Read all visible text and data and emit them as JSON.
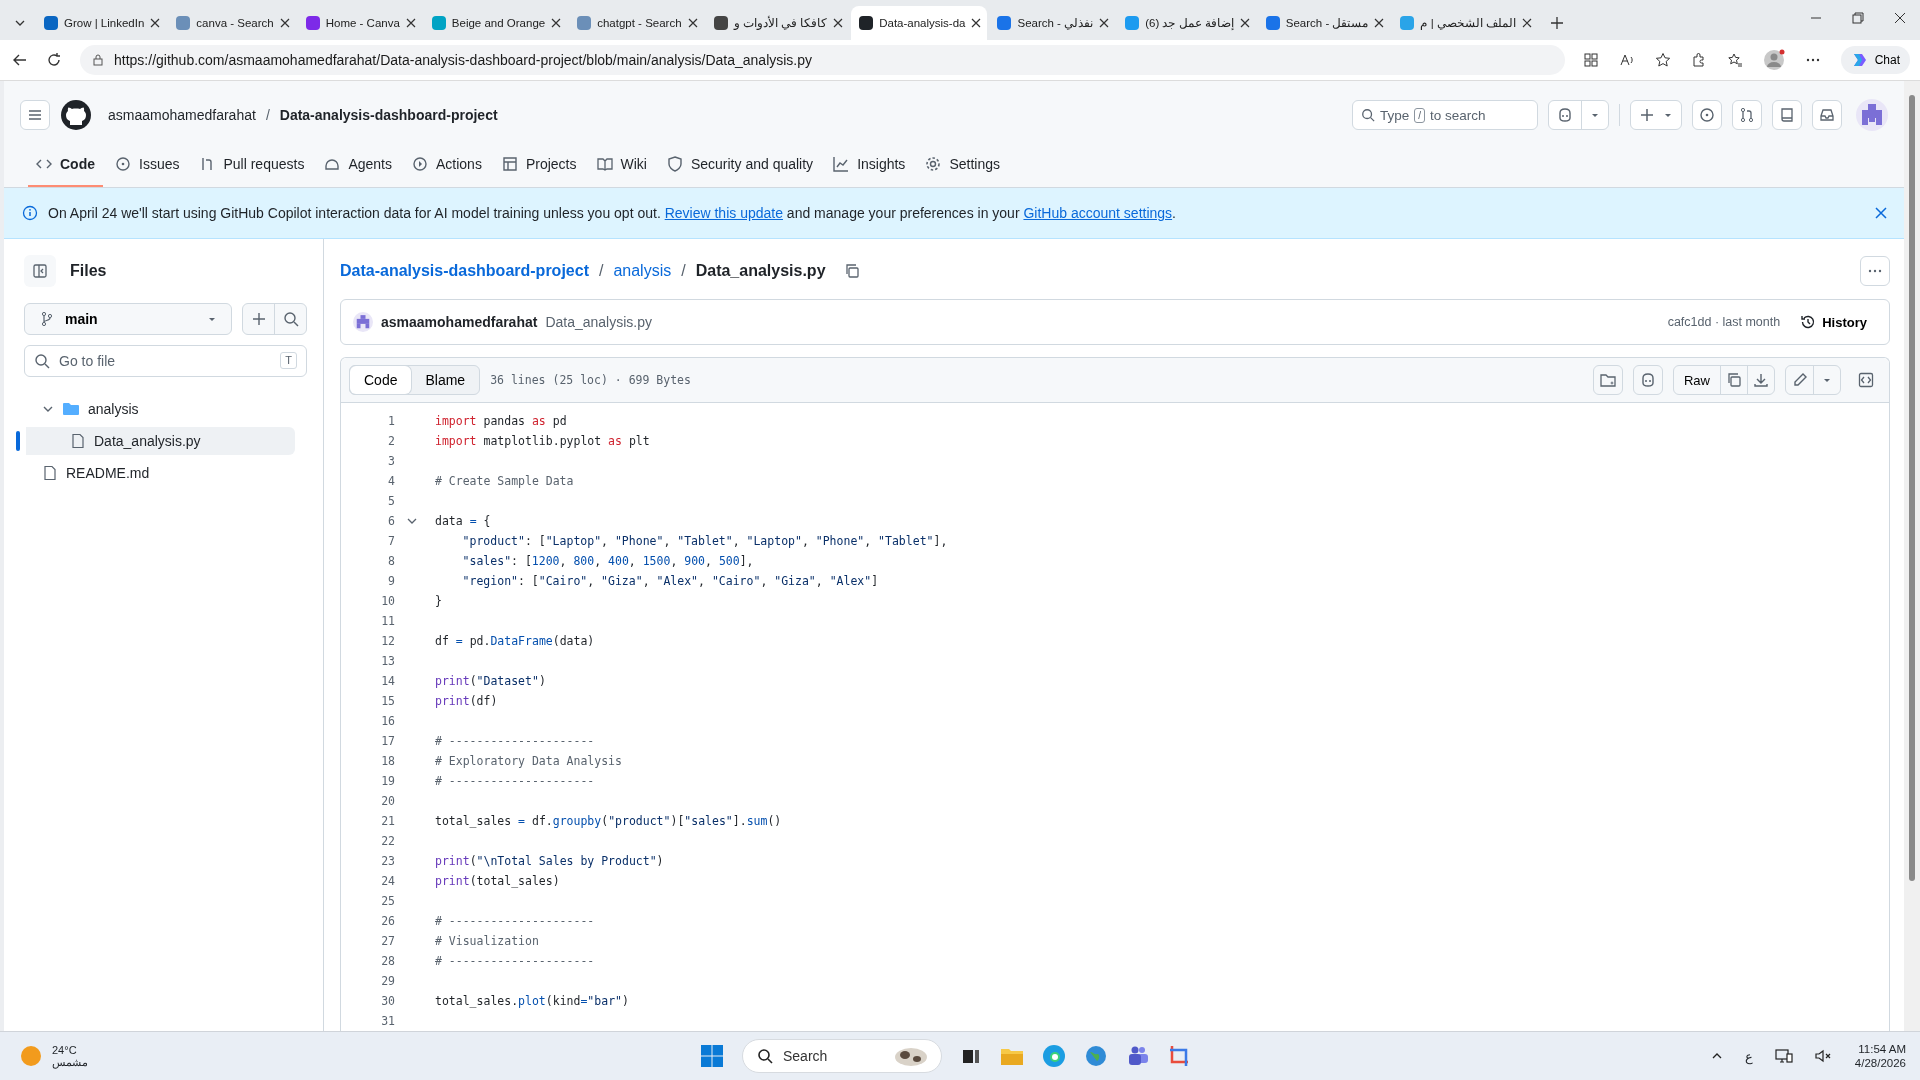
{
  "browser": {
    "tabs": [
      {
        "title": "Grow | LinkedIn",
        "selected": false,
        "color": "#0a66c2"
      },
      {
        "title": "canva - Search",
        "selected": false,
        "color": "#6b8fb8"
      },
      {
        "title": "Home - Canva",
        "selected": false,
        "color": "#7d2ae8"
      },
      {
        "title": "Beige and Orange",
        "selected": false,
        "color": "#00a3c4"
      },
      {
        "title": "chatgpt - Search",
        "selected": false,
        "color": "#6b8fb8"
      },
      {
        "title": "كافكا في الأدوات و",
        "selected": false,
        "color": "#444444"
      },
      {
        "title": "Data-analysis-da",
        "selected": true,
        "color": "#1f2328"
      },
      {
        "title": "Search - نفذلي",
        "selected": false,
        "color": "#1a73e8"
      },
      {
        "title": "(6) إضافة عمل جد",
        "selected": false,
        "color": "#1d9bf0"
      },
      {
        "title": "Search - مستقل",
        "selected": false,
        "color": "#1a73e8"
      },
      {
        "title": "الملف الشخصي | م",
        "selected": false,
        "color": "#2aa4e8"
      }
    ],
    "url": "https://github.com/asmaamohamedfarahat/Data-analysis-dashboard-project/blob/main/analysis/Data_analysis.py",
    "chat_label": "Chat"
  },
  "header": {
    "owner": "asmaamohamedfarahat",
    "separator": "/",
    "repo": "Data-analysis-dashboard-project",
    "search": {
      "before": "Type",
      "key": "/",
      "after": "to search"
    }
  },
  "repo_nav": [
    {
      "label": "Code",
      "selected": true
    },
    {
      "label": "Issues",
      "selected": false
    },
    {
      "label": "Pull requests",
      "selected": false
    },
    {
      "label": "Agents",
      "selected": false
    },
    {
      "label": "Actions",
      "selected": false
    },
    {
      "label": "Projects",
      "selected": false
    },
    {
      "label": "Wiki",
      "selected": false
    },
    {
      "label": "Security and quality",
      "selected": false
    },
    {
      "label": "Insights",
      "selected": false
    },
    {
      "label": "Settings",
      "selected": false
    }
  ],
  "banner": {
    "text": "On April 24 we'll start using GitHub Copilot interaction data for AI model training unless you opt out.",
    "link_1": "Review this update",
    "middle": "and manage your preferences in your",
    "link_2": "GitHub account settings",
    "end": "."
  },
  "sidebar": {
    "title": "Files",
    "branch": "main",
    "go_to_file": {
      "placeholder": "Go to file",
      "key": "T"
    },
    "tree": [
      {
        "name": "analysis",
        "kind": "folder",
        "expanded": true,
        "selected": false,
        "children": [
          {
            "name": "Data_analysis.py",
            "kind": "file",
            "selected": true
          }
        ]
      },
      {
        "name": "README.md",
        "kind": "file",
        "selected": false
      }
    ]
  },
  "breadcrumb": [
    {
      "label": "Data-analysis-dashboard-project",
      "kind": "link"
    },
    {
      "label": "analysis",
      "kind": "link"
    },
    {
      "label": "Data_analysis.py",
      "kind": "current"
    }
  ],
  "crumb_separator": "/",
  "commit": {
    "author": "asmaamohamedfarahat",
    "message": "Data_analysis.py",
    "info": "cafc1dd · last month",
    "history_label": "History"
  },
  "file_toolbar": {
    "views": [
      {
        "label": "Code",
        "selected": true
      },
      {
        "label": "Blame",
        "selected": false
      }
    ],
    "stats": "36 lines (25 loc) · 699 Bytes",
    "raw_label": "Raw"
  },
  "code_lines": [
    {
      "n": "1",
      "tokens": [
        {
          "kind": "kw",
          "text": "import"
        },
        {
          "kind": "plain",
          "text": " pandas "
        },
        {
          "kind": "kw",
          "text": "as"
        },
        {
          "kind": "plain",
          "text": " pd"
        }
      ]
    },
    {
      "n": "2",
      "tokens": [
        {
          "kind": "kw",
          "text": "import"
        },
        {
          "kind": "plain",
          "text": " matplotlib.pyplot "
        },
        {
          "kind": "kw",
          "text": "as"
        },
        {
          "kind": "plain",
          "text": " plt"
        }
      ]
    },
    {
      "n": "3"
    },
    {
      "n": "4",
      "tokens": [
        {
          "kind": "com",
          "text": "# Create Sample Data"
        }
      ]
    },
    {
      "n": "5"
    },
    {
      "n": "6",
      "expanded": true,
      "tokens": [
        {
          "kind": "plain",
          "text": "data "
        },
        {
          "kind": "op",
          "text": "="
        },
        {
          "kind": "plain",
          "text": " {"
        }
      ],
      "children": [
        {
          "n": "7",
          "tokens": [
            {
              "kind": "str",
              "text": "\"product\""
            },
            {
              "kind": "plain",
              "text": ": ["
            },
            {
              "kind": "str",
              "text": "\"Laptop\""
            },
            {
              "kind": "plain",
              "text": ", "
            },
            {
              "kind": "str",
              "text": "\"Phone\""
            },
            {
              "kind": "plain",
              "text": ", "
            },
            {
              "kind": "str",
              "text": "\"Tablet\""
            },
            {
              "kind": "plain",
              "text": ", "
            },
            {
              "kind": "str",
              "text": "\"Laptop\""
            },
            {
              "kind": "plain",
              "text": ", "
            },
            {
              "kind": "str",
              "text": "\"Phone\""
            },
            {
              "kind": "plain",
              "text": ", "
            },
            {
              "kind": "str",
              "text": "\"Tablet\""
            },
            {
              "kind": "plain",
              "text": "],"
            }
          ]
        },
        {
          "n": "8",
          "tokens": [
            {
              "kind": "str",
              "text": "\"sales\""
            },
            {
              "kind": "plain",
              "text": ": ["
            },
            {
              "kind": "num",
              "text": "1200"
            },
            {
              "kind": "plain",
              "text": ", "
            },
            {
              "kind": "num",
              "text": "800"
            },
            {
              "kind": "plain",
              "text": ", "
            },
            {
              "kind": "num",
              "text": "400"
            },
            {
              "kind": "plain",
              "text": ", "
            },
            {
              "kind": "num",
              "text": "1500"
            },
            {
              "kind": "plain",
              "text": ", "
            },
            {
              "kind": "num",
              "text": "900"
            },
            {
              "kind": "plain",
              "text": ", "
            },
            {
              "kind": "num",
              "text": "500"
            },
            {
              "kind": "plain",
              "text": "],"
            }
          ]
        },
        {
          "n": "9",
          "tokens": [
            {
              "kind": "str",
              "text": "\"region\""
            },
            {
              "kind": "plain",
              "text": ": ["
            },
            {
              "kind": "str",
              "text": "\"Cairo\""
            },
            {
              "kind": "plain",
              "text": ", "
            },
            {
              "kind": "str",
              "text": "\"Giza\""
            },
            {
              "kind": "plain",
              "text": ", "
            },
            {
              "kind": "str",
              "text": "\"Alex\""
            },
            {
              "kind": "plain",
              "text": ", "
            },
            {
              "kind": "str",
              "text": "\"Cairo\""
            },
            {
              "kind": "plain",
              "text": ", "
            },
            {
              "kind": "str",
              "text": "\"Giza\""
            },
            {
              "kind": "plain",
              "text": ", "
            },
            {
              "kind": "str",
              "text": "\"Alex\""
            },
            {
              "kind": "plain",
              "text": "]"
            }
          ]
        }
      ]
    },
    {
      "n": "10",
      "tokens": [
        {
          "kind": "plain",
          "text": "}"
        }
      ]
    },
    {
      "n": "11"
    },
    {
      "n": "12",
      "tokens": [
        {
          "kind": "plain",
          "text": "df "
        },
        {
          "kind": "op",
          "text": "="
        },
        {
          "kind": "plain",
          "text": " pd."
        },
        {
          "kind": "fn",
          "text": "DataFrame"
        },
        {
          "kind": "plain",
          "text": "(data)"
        }
      ]
    },
    {
      "n": "13"
    },
    {
      "n": "14",
      "tokens": [
        {
          "kind": "builtin",
          "text": "print"
        },
        {
          "kind": "plain",
          "text": "("
        },
        {
          "kind": "str",
          "text": "\"Dataset\""
        },
        {
          "kind": "plain",
          "text": ")"
        }
      ]
    },
    {
      "n": "15",
      "tokens": [
        {
          "kind": "builtin",
          "text": "print"
        },
        {
          "kind": "plain",
          "text": "(df)"
        }
      ]
    },
    {
      "n": "16"
    },
    {
      "n": "17",
      "tokens": [
        {
          "kind": "com",
          "text": "# ---------------------"
        }
      ]
    },
    {
      "n": "18",
      "tokens": [
        {
          "kind": "com",
          "text": "# Exploratory Data Analysis"
        }
      ]
    },
    {
      "n": "19",
      "tokens": [
        {
          "kind": "com",
          "text": "# ---------------------"
        }
      ]
    },
    {
      "n": "20"
    },
    {
      "n": "21",
      "tokens": [
        {
          "kind": "plain",
          "text": "total_sales "
        },
        {
          "kind": "op",
          "text": "="
        },
        {
          "kind": "plain",
          "text": " df."
        },
        {
          "kind": "fn",
          "text": "groupby"
        },
        {
          "kind": "plain",
          "text": "("
        },
        {
          "kind": "str",
          "text": "\"product\""
        },
        {
          "kind": "plain",
          "text": ")["
        },
        {
          "kind": "str",
          "text": "\"sales\""
        },
        {
          "kind": "plain",
          "text": "]."
        },
        {
          "kind": "fn",
          "text": "sum"
        },
        {
          "kind": "plain",
          "text": "()"
        }
      ]
    },
    {
      "n": "22"
    },
    {
      "n": "23",
      "tokens": [
        {
          "kind": "builtin",
          "text": "print"
        },
        {
          "kind": "plain",
          "text": "("
        },
        {
          "kind": "str",
          "text": "\"\\nTotal Sales by Product\""
        },
        {
          "kind": "plain",
          "text": ")"
        }
      ]
    },
    {
      "n": "24",
      "tokens": [
        {
          "kind": "builtin",
          "text": "print"
        },
        {
          "kind": "plain",
          "text": "(total_sales)"
        }
      ]
    },
    {
      "n": "25"
    },
    {
      "n": "26",
      "tokens": [
        {
          "kind": "com",
          "text": "# ---------------------"
        }
      ]
    },
    {
      "n": "27",
      "tokens": [
        {
          "kind": "com",
          "text": "# Visualization"
        }
      ]
    },
    {
      "n": "28",
      "tokens": [
        {
          "kind": "com",
          "text": "# ---------------------"
        }
      ]
    },
    {
      "n": "29"
    },
    {
      "n": "30",
      "tokens": [
        {
          "kind": "plain",
          "text": "total_sales."
        },
        {
          "kind": "fn",
          "text": "plot"
        },
        {
          "kind": "plain",
          "text": "(kind"
        },
        {
          "kind": "op",
          "text": "="
        },
        {
          "kind": "str",
          "text": "\"bar\""
        },
        {
          "kind": "plain",
          "text": ")"
        }
      ]
    },
    {
      "n": "31"
    }
  ],
  "taskbar": {
    "temperature": "24°C",
    "condition": "مشمس",
    "search_placeholder": "Search",
    "language": "ع",
    "time": "11:54 AM",
    "date": "4/28/2026"
  }
}
